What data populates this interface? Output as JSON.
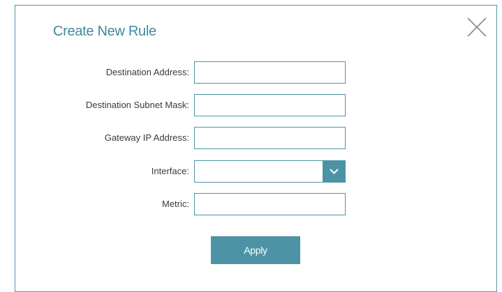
{
  "dialog": {
    "title": "Create New Rule",
    "close_icon": "close-icon"
  },
  "fields": [
    {
      "label": "Destination Address:",
      "value": ""
    },
    {
      "label": "Destination Subnet Mask:",
      "value": ""
    },
    {
      "label": "Gateway IP Address:",
      "value": ""
    },
    {
      "label": "Interface:",
      "selected": ""
    },
    {
      "label": "Metric:",
      "value": ""
    }
  ],
  "apply_label": "Apply",
  "colors": {
    "accent": "#4c94a5",
    "title": "#3f8a9c",
    "label": "#3a3a3a",
    "close": "#8a8a8a"
  }
}
